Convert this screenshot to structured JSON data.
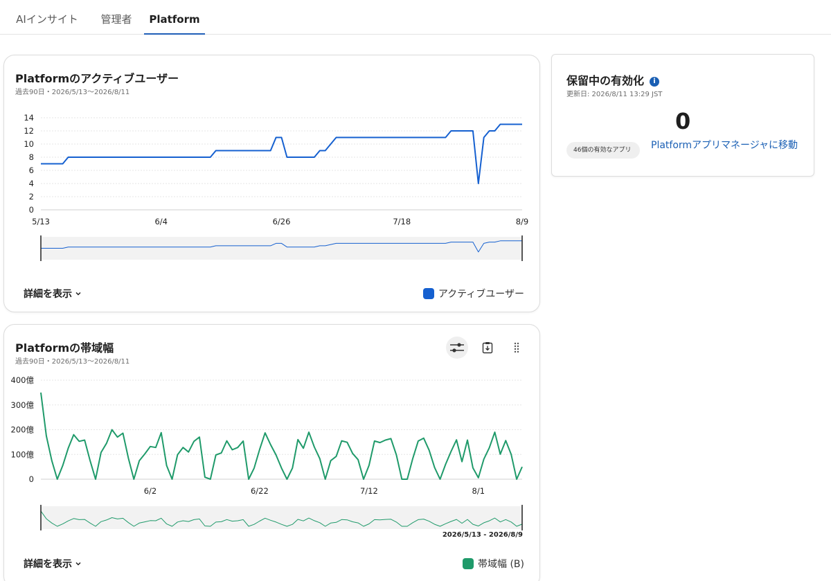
{
  "tabs": [
    {
      "label": "AIインサイト",
      "active": false
    },
    {
      "label": "管理者",
      "active": false
    },
    {
      "label": "Platform",
      "active": true
    }
  ],
  "users_card": {
    "title": "Platformのアクティブユーザー",
    "subtitle": "過去90日・2026/5/13〜2026/8/11",
    "details_label": "詳細を表示",
    "legend_label": "アクティブユーザー"
  },
  "bandwidth_card": {
    "title": "Platformの帯域幅",
    "subtitle": "過去90日・2026/5/13〜2026/8/11",
    "range_label": "2026/5/13 - 2026/8/9",
    "details_label": "詳細を表示",
    "legend_label": "帯域幅 (B)",
    "icons": [
      "filter-sliders-icon",
      "clipboard-download-icon",
      "drag-handle-icon"
    ]
  },
  "pending_card": {
    "title": "保留中の有効化",
    "updated": "更新日: 2026/8/11 13:29 JST",
    "count": "0",
    "pill": "46個の有効なアプリ",
    "link": "Platformアプリマネージャに移動"
  },
  "colors": {
    "users_series": "#1560d0",
    "bandwidth_series": "#1f9a6a",
    "tab_underline": "#1f5fb8",
    "link": "#1a5fb4"
  },
  "chart_data": [
    {
      "type": "line",
      "title": "Platformのアクティブユーザー",
      "x_tick_labels": [
        "5/13",
        "6/4",
        "6/26",
        "7/18",
        "8/9"
      ],
      "y_tick_labels": [
        "0",
        "2",
        "4",
        "6",
        "8",
        "10",
        "12",
        "14"
      ],
      "ylim": [
        0,
        14
      ],
      "grid": true,
      "legend_placement": "bottom-right",
      "x_start": "2026-05-13",
      "x_end": "2026-08-09",
      "series": [
        {
          "name": "アクティブユーザー",
          "points": [
            [
              "2026-05-13",
              7
            ],
            [
              "2026-05-17",
              7
            ],
            [
              "2026-05-18",
              8
            ],
            [
              "2026-06-13",
              8
            ],
            [
              "2026-06-14",
              9
            ],
            [
              "2026-06-24",
              9
            ],
            [
              "2026-06-25",
              11
            ],
            [
              "2026-06-26",
              11
            ],
            [
              "2026-06-27",
              8
            ],
            [
              "2026-07-02",
              8
            ],
            [
              "2026-07-03",
              9
            ],
            [
              "2026-07-04",
              9
            ],
            [
              "2026-07-06",
              11
            ],
            [
              "2026-07-26",
              11
            ],
            [
              "2026-07-27",
              12
            ],
            [
              "2026-07-31",
              12
            ],
            [
              "2026-08-01",
              4
            ],
            [
              "2026-08-02",
              11
            ],
            [
              "2026-08-03",
              12
            ],
            [
              "2026-08-04",
              12
            ],
            [
              "2026-08-05",
              13
            ],
            [
              "2026-08-09",
              13
            ]
          ]
        }
      ]
    },
    {
      "type": "line",
      "title": "Platformの帯域幅",
      "x_tick_labels": [
        "6/2",
        "6/22",
        "7/12",
        "8/1"
      ],
      "y_tick_labels": [
        "0",
        "100億",
        "200億",
        "300億",
        "400億"
      ],
      "ylim": [
        0,
        40000000000
      ],
      "grid": true,
      "legend_placement": "bottom-right",
      "x_start": "2026-05-13",
      "x_end": "2026-08-09",
      "series": [
        {
          "name": "帯域幅 (B)",
          "values": [
            35000000000,
            17500000000,
            7500000000,
            0,
            5500000000,
            12500000000,
            18000000000,
            15300000000,
            15800000000,
            7500000000,
            0,
            10800000000,
            14500000000,
            20000000000,
            17000000000,
            18600000000,
            8500000000,
            0,
            7500000000,
            10200000000,
            13200000000,
            12800000000,
            18800000000,
            5500000000,
            0,
            9900000000,
            12800000000,
            11000000000,
            15300000000,
            17000000000,
            800000000,
            0,
            9800000000,
            10600000000,
            15500000000,
            11900000000,
            12800000000,
            15400000000,
            0,
            4500000000,
            12000000000,
            18700000000,
            14000000000,
            9800000000,
            4500000000,
            0,
            4500000000,
            16000000000,
            12500000000,
            19000000000,
            13000000000,
            8300000000,
            0,
            7500000000,
            9200000000,
            15500000000,
            14900000000,
            10400000000,
            7900000000,
            0,
            5600000000,
            15400000000,
            14800000000,
            15800000000,
            16400000000,
            9800000000,
            0,
            0,
            8300000000,
            15400000000,
            16600000000,
            11700000000,
            4700000000,
            0,
            6000000000,
            11200000000,
            15900000000,
            7100000000,
            15800000000,
            4600000000,
            600000000,
            8100000000,
            12700000000,
            19000000000,
            10100000000,
            15600000000,
            10000000000,
            0,
            5000000000
          ]
        }
      ]
    }
  ]
}
